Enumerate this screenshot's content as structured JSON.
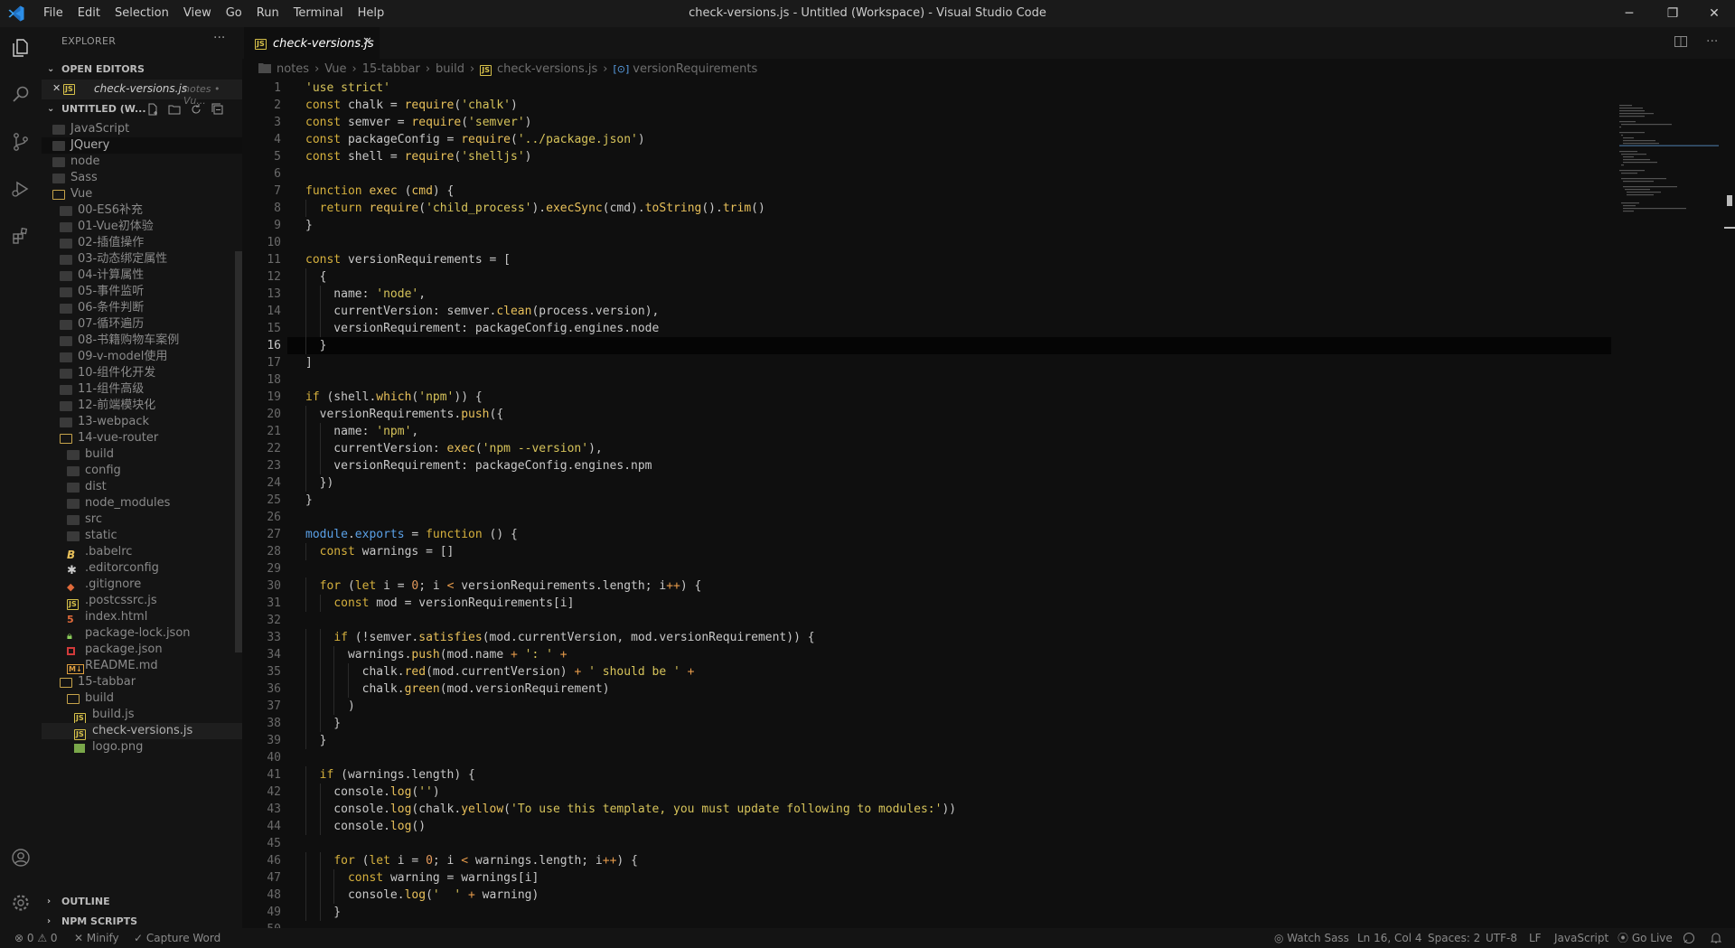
{
  "window": {
    "title": "check-versions.js - Untitled (Workspace) - Visual Studio Code",
    "menu": [
      "File",
      "Edit",
      "Selection",
      "View",
      "Go",
      "Run",
      "Terminal",
      "Help"
    ],
    "controls": [
      "─",
      "❐",
      "✕"
    ]
  },
  "activity_bar": {
    "icons": [
      "explorer-icon",
      "search-icon",
      "source-control-icon",
      "run-debug-icon",
      "extensions-icon"
    ],
    "bottom_icons": [
      "account-icon",
      "settings-gear-icon"
    ]
  },
  "sidebar": {
    "title": "EXPLORER",
    "more": "···",
    "open_editors": {
      "label": "OPEN EDITORS",
      "items": [
        {
          "close": "✕",
          "name": "check-versions.js",
          "hint": "notes • Vu..."
        }
      ]
    },
    "workspace": {
      "label": "UNTITLED (W..."
    },
    "tree": [
      {
        "name": "JavaScript",
        "type": "folder",
        "depth": 1
      },
      {
        "name": "JQuery",
        "type": "folder",
        "depth": 1,
        "selected": true
      },
      {
        "name": "node",
        "type": "folder",
        "depth": 1
      },
      {
        "name": "Sass",
        "type": "folder",
        "depth": 1
      },
      {
        "name": "Vue",
        "type": "folder-open",
        "depth": 1
      },
      {
        "name": "00-ES6补充",
        "type": "folder",
        "depth": 2
      },
      {
        "name": "01-Vue初体验",
        "type": "folder",
        "depth": 2
      },
      {
        "name": "02-插值操作",
        "type": "folder",
        "depth": 2
      },
      {
        "name": "03-动态绑定属性",
        "type": "folder",
        "depth": 2
      },
      {
        "name": "04-计算属性",
        "type": "folder",
        "depth": 2
      },
      {
        "name": "05-事件监听",
        "type": "folder",
        "depth": 2
      },
      {
        "name": "06-条件判断",
        "type": "folder",
        "depth": 2
      },
      {
        "name": "07-循环遍历",
        "type": "folder",
        "depth": 2
      },
      {
        "name": "08-书籍购物车案例",
        "type": "folder",
        "depth": 2
      },
      {
        "name": "09-v-model使用",
        "type": "folder",
        "depth": 2
      },
      {
        "name": "10-组件化开发",
        "type": "folder",
        "depth": 2
      },
      {
        "name": "11-组件高级",
        "type": "folder",
        "depth": 2
      },
      {
        "name": "12-前端模块化",
        "type": "folder",
        "depth": 2
      },
      {
        "name": "13-webpack",
        "type": "folder",
        "depth": 2
      },
      {
        "name": "14-vue-router",
        "type": "folder-open",
        "depth": 2
      },
      {
        "name": "build",
        "type": "folder",
        "depth": 3
      },
      {
        "name": "config",
        "type": "folder",
        "depth": 3
      },
      {
        "name": "dist",
        "type": "folder",
        "depth": 3
      },
      {
        "name": "node_modules",
        "type": "folder",
        "depth": 3
      },
      {
        "name": "src",
        "type": "folder",
        "depth": 3
      },
      {
        "name": "static",
        "type": "folder",
        "depth": 3
      },
      {
        "name": ".babelrc",
        "type": "babel",
        "depth": 3
      },
      {
        "name": ".editorconfig",
        "type": "config",
        "depth": 3
      },
      {
        "name": ".gitignore",
        "type": "git",
        "depth": 3
      },
      {
        "name": ".postcssrc.js",
        "type": "js",
        "depth": 3
      },
      {
        "name": "index.html",
        "type": "html",
        "depth": 3
      },
      {
        "name": "package-lock.json",
        "type": "lock",
        "depth": 3
      },
      {
        "name": "package.json",
        "type": "npm",
        "depth": 3
      },
      {
        "name": "README.md",
        "type": "md",
        "depth": 3
      },
      {
        "name": "15-tabbar",
        "type": "folder-open",
        "depth": 2
      },
      {
        "name": "build",
        "type": "folder-open",
        "depth": 3
      },
      {
        "name": "build.js",
        "type": "js",
        "depth": 4
      },
      {
        "name": "check-versions.js",
        "type": "js",
        "depth": 4,
        "active": true
      },
      {
        "name": "logo.png",
        "type": "png",
        "depth": 4
      }
    ],
    "outline": "OUTLINE",
    "npm_scripts": "NPM SCRIPTS"
  },
  "editor": {
    "tab": {
      "name": "check-versions.js",
      "badge": "JS",
      "close": "✕"
    },
    "breadcrumb": [
      "notes",
      "Vue",
      "15-tabbar",
      "build",
      "check-versions.js",
      "versionRequirements"
    ],
    "breadcrumb_sep": "›",
    "current_line": 16,
    "lines": [
      [
        [
          "str",
          "'use strict'"
        ]
      ],
      [
        [
          "kw",
          "const "
        ],
        [
          "plain",
          "chalk = "
        ],
        [
          "fn",
          "require"
        ],
        [
          "plain",
          "("
        ],
        [
          "str",
          "'chalk'"
        ],
        [
          "plain",
          ")"
        ]
      ],
      [
        [
          "kw",
          "const "
        ],
        [
          "plain",
          "semver = "
        ],
        [
          "fn",
          "require"
        ],
        [
          "plain",
          "("
        ],
        [
          "str",
          "'semver'"
        ],
        [
          "plain",
          ")"
        ]
      ],
      [
        [
          "kw",
          "const "
        ],
        [
          "plain",
          "packageConfig = "
        ],
        [
          "fn",
          "require"
        ],
        [
          "plain",
          "("
        ],
        [
          "str",
          "'../package.json'"
        ],
        [
          "plain",
          ")"
        ]
      ],
      [
        [
          "kw",
          "const "
        ],
        [
          "plain",
          "shell = "
        ],
        [
          "fn",
          "require"
        ],
        [
          "plain",
          "("
        ],
        [
          "str",
          "'shelljs'"
        ],
        [
          "plain",
          ")"
        ]
      ],
      [],
      [
        [
          "kw",
          "function "
        ],
        [
          "fn",
          "exec "
        ],
        [
          "plain",
          "("
        ],
        [
          "fn",
          "cmd"
        ],
        [
          "plain",
          ") {"
        ]
      ],
      [
        [
          "plain",
          "  "
        ],
        [
          "kw",
          "return "
        ],
        [
          "fn",
          "require"
        ],
        [
          "plain",
          "("
        ],
        [
          "str",
          "'child_process'"
        ],
        [
          "plain",
          ")."
        ],
        [
          "fn",
          "execSync"
        ],
        [
          "plain",
          "(cmd)."
        ],
        [
          "fn",
          "toString"
        ],
        [
          "plain",
          "()."
        ],
        [
          "fn",
          "trim"
        ],
        [
          "plain",
          "()"
        ]
      ],
      [
        [
          "plain",
          "}"
        ]
      ],
      [],
      [
        [
          "kw",
          "const "
        ],
        [
          "plain",
          "versionRequirements = ["
        ]
      ],
      [
        [
          "plain",
          "  {"
        ]
      ],
      [
        [
          "plain",
          "    name: "
        ],
        [
          "str",
          "'node'"
        ],
        [
          "plain",
          ","
        ]
      ],
      [
        [
          "plain",
          "    currentVersion: semver."
        ],
        [
          "fn",
          "clean"
        ],
        [
          "plain",
          "(process.version),"
        ]
      ],
      [
        [
          "plain",
          "    versionRequirement: packageConfig.engines.node"
        ]
      ],
      [
        [
          "plain",
          "  }"
        ]
      ],
      [
        [
          "plain",
          "]"
        ]
      ],
      [],
      [
        [
          "kw",
          "if "
        ],
        [
          "plain",
          "(shell."
        ],
        [
          "fn",
          "which"
        ],
        [
          "plain",
          "("
        ],
        [
          "str",
          "'npm'"
        ],
        [
          "plain",
          ")) {"
        ]
      ],
      [
        [
          "plain",
          "  versionRequirements."
        ],
        [
          "fn",
          "push"
        ],
        [
          "plain",
          "({"
        ]
      ],
      [
        [
          "plain",
          "    name: "
        ],
        [
          "str",
          "'npm'"
        ],
        [
          "plain",
          ","
        ]
      ],
      [
        [
          "plain",
          "    currentVersion: "
        ],
        [
          "fn",
          "exec"
        ],
        [
          "plain",
          "("
        ],
        [
          "str",
          "'npm --version'"
        ],
        [
          "plain",
          "),"
        ]
      ],
      [
        [
          "plain",
          "    versionRequirement: packageConfig.engines.npm"
        ]
      ],
      [
        [
          "plain",
          "  })"
        ]
      ],
      [
        [
          "plain",
          "}"
        ]
      ],
      [],
      [
        [
          "mod",
          "module"
        ],
        [
          "plain",
          "."
        ],
        [
          "mod",
          "exports"
        ],
        [
          "plain",
          " = "
        ],
        [
          "kw",
          "function "
        ],
        [
          "plain",
          "() {"
        ]
      ],
      [
        [
          "plain",
          "  "
        ],
        [
          "kw",
          "const "
        ],
        [
          "plain",
          "warnings = []"
        ]
      ],
      [],
      [
        [
          "plain",
          "  "
        ],
        [
          "kw",
          "for "
        ],
        [
          "plain",
          "("
        ],
        [
          "kw",
          "let "
        ],
        [
          "plain",
          "i = "
        ],
        [
          "num",
          "0"
        ],
        [
          "plain",
          "; i "
        ],
        [
          "op",
          "<"
        ],
        [
          "plain",
          " versionRequirements.length; i"
        ],
        [
          "op",
          "++"
        ],
        [
          "plain",
          ") {"
        ]
      ],
      [
        [
          "plain",
          "    "
        ],
        [
          "kw",
          "const "
        ],
        [
          "plain",
          "mod = versionRequirements[i]"
        ]
      ],
      [],
      [
        [
          "plain",
          "    "
        ],
        [
          "kw",
          "if "
        ],
        [
          "plain",
          "(!semver."
        ],
        [
          "fn",
          "satisfies"
        ],
        [
          "plain",
          "(mod.currentVersion, mod.versionRequirement)) {"
        ]
      ],
      [
        [
          "plain",
          "      warnings."
        ],
        [
          "fn",
          "push"
        ],
        [
          "plain",
          "(mod.name "
        ],
        [
          "op",
          "+"
        ],
        [
          "plain",
          " "
        ],
        [
          "str",
          "': '"
        ],
        [
          "plain",
          " "
        ],
        [
          "op",
          "+"
        ]
      ],
      [
        [
          "plain",
          "        chalk."
        ],
        [
          "fn",
          "red"
        ],
        [
          "plain",
          "(mod.currentVersion) "
        ],
        [
          "op",
          "+"
        ],
        [
          "plain",
          " "
        ],
        [
          "str",
          "' should be '"
        ],
        [
          "plain",
          " "
        ],
        [
          "op",
          "+"
        ]
      ],
      [
        [
          "plain",
          "        chalk."
        ],
        [
          "fn",
          "green"
        ],
        [
          "plain",
          "(mod.versionRequirement)"
        ]
      ],
      [
        [
          "plain",
          "      )"
        ]
      ],
      [
        [
          "plain",
          "    }"
        ]
      ],
      [
        [
          "plain",
          "  }"
        ]
      ],
      [],
      [
        [
          "plain",
          "  "
        ],
        [
          "kw",
          "if "
        ],
        [
          "plain",
          "(warnings.length) {"
        ]
      ],
      [
        [
          "plain",
          "    console."
        ],
        [
          "fn",
          "log"
        ],
        [
          "plain",
          "("
        ],
        [
          "str",
          "''"
        ],
        [
          "plain",
          ")"
        ]
      ],
      [
        [
          "plain",
          "    console."
        ],
        [
          "fn",
          "log"
        ],
        [
          "plain",
          "(chalk."
        ],
        [
          "fn",
          "yellow"
        ],
        [
          "plain",
          "("
        ],
        [
          "str",
          "'To use this template, you must update following to modules:'"
        ],
        [
          "plain",
          "))"
        ]
      ],
      [
        [
          "plain",
          "    console."
        ],
        [
          "fn",
          "log"
        ],
        [
          "plain",
          "()"
        ]
      ],
      [],
      [
        [
          "plain",
          "    "
        ],
        [
          "kw",
          "for "
        ],
        [
          "plain",
          "("
        ],
        [
          "kw",
          "let "
        ],
        [
          "plain",
          "i = "
        ],
        [
          "num",
          "0"
        ],
        [
          "plain",
          "; i "
        ],
        [
          "op",
          "<"
        ],
        [
          "plain",
          " warnings.length; i"
        ],
        [
          "op",
          "++"
        ],
        [
          "plain",
          ") {"
        ]
      ],
      [
        [
          "plain",
          "      "
        ],
        [
          "kw",
          "const "
        ],
        [
          "plain",
          "warning = warnings[i]"
        ]
      ],
      [
        [
          "plain",
          "      console."
        ],
        [
          "fn",
          "log"
        ],
        [
          "plain",
          "("
        ],
        [
          "str",
          "'  '"
        ],
        [
          "plain",
          " "
        ],
        [
          "op",
          "+"
        ],
        [
          "plain",
          " warning)"
        ]
      ],
      [
        [
          "plain",
          "    }"
        ]
      ],
      []
    ]
  },
  "statusbar": {
    "problems": "⊗ 0  ⚠ 0",
    "minify": "✕ Minify",
    "capture_word": "✓ Capture Word",
    "watch_sass": "◎ Watch Sass",
    "cursor": "Ln 16, Col 4",
    "spaces": "Spaces: 2",
    "encoding": "UTF-8",
    "eol": "LF",
    "language": "JavaScript",
    "go_live": "⦿ Go Live",
    "feedback_icon": "feedback-icon",
    "bell_icon": "bell-icon"
  },
  "colors": {
    "keyword": "#d5b03d",
    "string": "#d6c35a",
    "function": "#e8c05a",
    "module": "#5aa0e6",
    "number": "#e49a5b",
    "accent_logo": "#2c8ee8"
  }
}
